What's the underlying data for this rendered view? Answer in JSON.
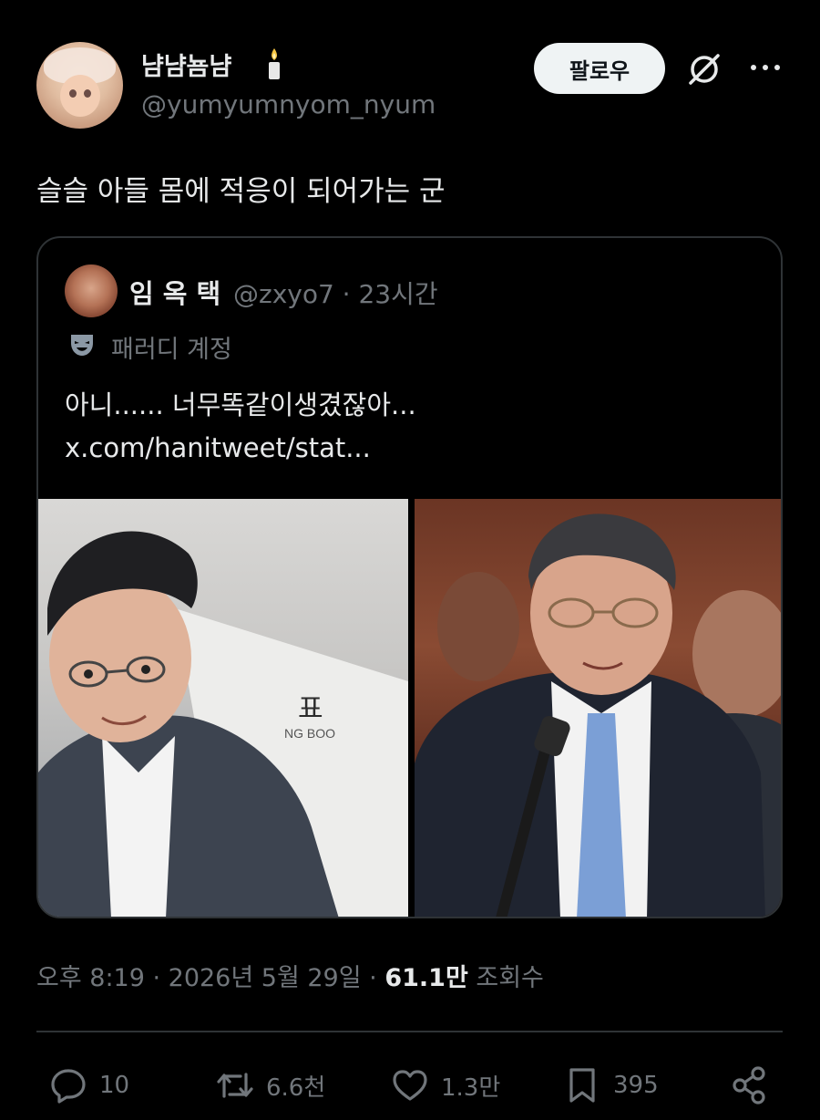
{
  "author": {
    "display_name": "냠냠뇸냠",
    "handle": "@yumyumnyom_nyum"
  },
  "header": {
    "follow_label": "팔로우"
  },
  "tweet": {
    "text": "슬슬 아들 몸에 적응이 되어가는 군"
  },
  "quoted": {
    "name": "임 옥 택",
    "meta": "@zxyo7 · 23시간",
    "parody_label": "패러디 계정",
    "text": "아니...... 너무똑같이생겼잖아...",
    "link": "x.com/hanitweet/stat..."
  },
  "footer": {
    "time": "오후 8:19 · 2026년 5월 29일 · ",
    "views_count": "61.1만",
    "views_label": " 조회수"
  },
  "actions": {
    "replies": "10",
    "retweets": "6.6천",
    "likes": "1.3만",
    "bookmarks": "395"
  },
  "colors": {
    "background": "#000000",
    "text_primary": "#e7e9ea",
    "text_secondary": "#71767b",
    "border": "#2f3336",
    "follow_bg": "#eff3f4"
  }
}
